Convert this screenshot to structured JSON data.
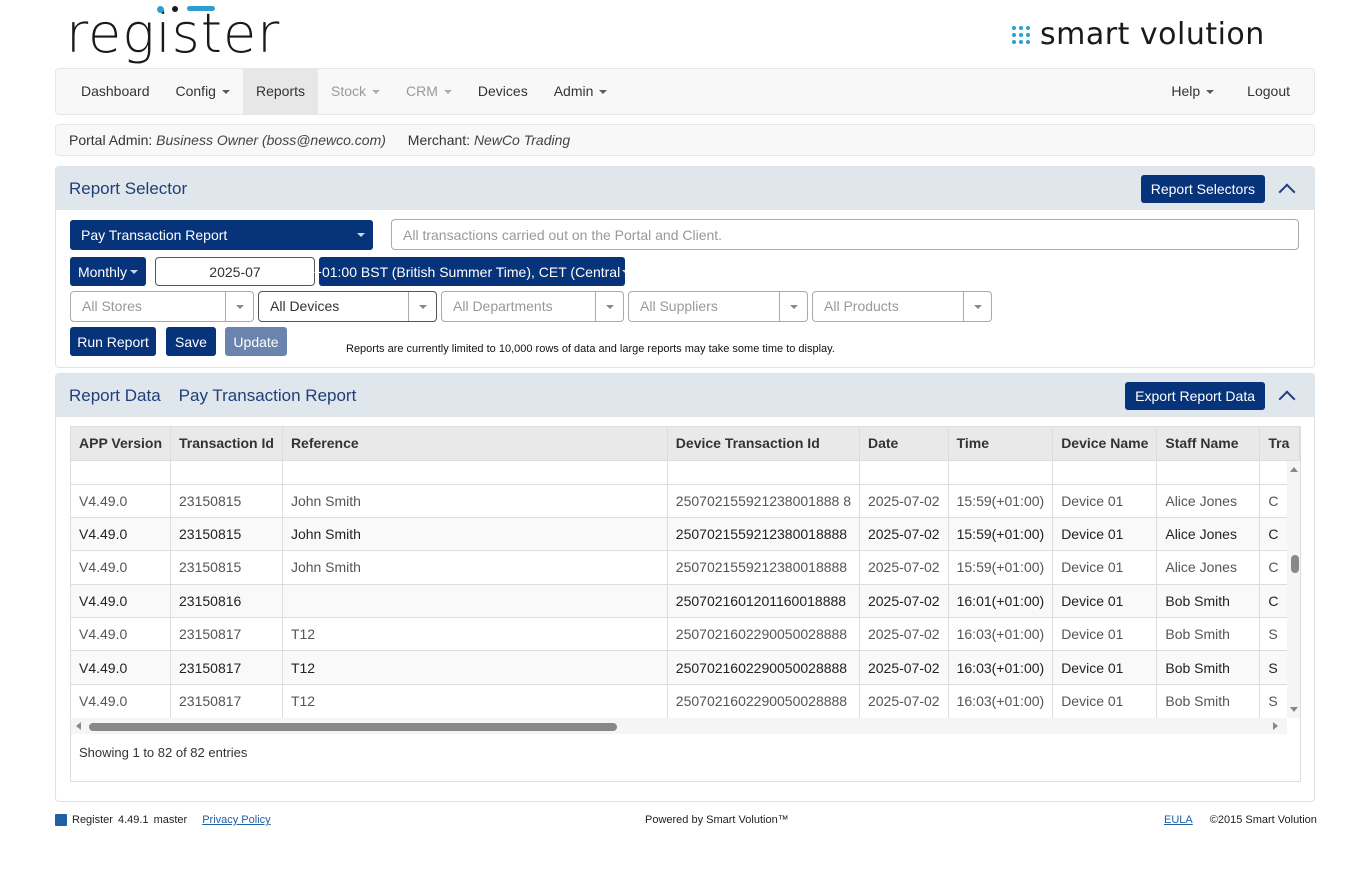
{
  "brand": {
    "logo": "register",
    "partner_logo": "smart volution",
    "accent": "#2a9fd0",
    "primary": "#06337a"
  },
  "nav": {
    "items": [
      {
        "label": "Dashboard",
        "dropdown": false,
        "state": "normal"
      },
      {
        "label": "Config",
        "dropdown": true,
        "state": "normal"
      },
      {
        "label": "Reports",
        "dropdown": false,
        "state": "active"
      },
      {
        "label": "Stock",
        "dropdown": true,
        "state": "disabled"
      },
      {
        "label": "CRM",
        "dropdown": true,
        "state": "disabled"
      },
      {
        "label": "Devices",
        "dropdown": false,
        "state": "normal"
      },
      {
        "label": "Admin",
        "dropdown": true,
        "state": "normal"
      }
    ],
    "help": "Help",
    "logout": "Logout"
  },
  "info": {
    "role_label": "Portal Admin:",
    "user": "Business Owner (boss@newco.com)",
    "merchant_label": "Merchant:",
    "merchant": "NewCo Trading"
  },
  "selector": {
    "title": "Report Selector",
    "selectors_button": "Report Selectors",
    "report": "Pay Transaction Report",
    "description_placeholder": "All transactions carried out on the Portal and Client.",
    "period": "Monthly",
    "date": "2025-07",
    "timezone": "+01:00 BST (British Summer Time), CET (Central",
    "filters": [
      {
        "label": "All Stores",
        "selected": false
      },
      {
        "label": "All Devices",
        "selected": true
      },
      {
        "label": "All Departments",
        "selected": false
      },
      {
        "label": "All Suppliers",
        "selected": false
      },
      {
        "label": "All Products",
        "selected": false
      }
    ],
    "run": "Run Report",
    "save": "Save",
    "update": "Update",
    "note": "Reports are currently limited to 10,000 rows of data and large reports may take some time to display."
  },
  "data": {
    "title": "Report Data",
    "subtitle": "Pay Transaction Report",
    "export": "Export Report Data",
    "columns": [
      "APP Version",
      "Transaction Id",
      "Reference",
      "Device Transaction Id",
      "Date",
      "Time",
      "Device Name",
      "Staff Name",
      "Tra"
    ],
    "rows": [
      [
        "V4.49.0",
        "23150815",
        "John Smith",
        "250702155921238001888 8",
        "2025-07-02",
        "15:59(+01:00)",
        "Device 01",
        "Alice Jones",
        "C"
      ],
      [
        "V4.49.0",
        "23150815",
        "John Smith",
        "2507021559212380018888",
        "2025-07-02",
        "15:59(+01:00)",
        "Device 01",
        "Alice Jones",
        "C"
      ],
      [
        "V4.49.0",
        "23150815",
        "John Smith",
        "2507021559212380018888",
        "2025-07-02",
        "15:59(+01:00)",
        "Device 01",
        "Alice Jones",
        "C"
      ],
      [
        "V4.49.0",
        "23150816",
        "",
        "2507021601201160018888",
        "2025-07-02",
        "16:01(+01:00)",
        "Device 01",
        "Bob Smith",
        "C"
      ],
      [
        "V4.49.0",
        "23150817",
        "T12",
        "2507021602290050028888",
        "2025-07-02",
        "16:03(+01:00)",
        "Device 01",
        "Bob Smith",
        "S"
      ],
      [
        "V4.49.0",
        "23150817",
        "T12",
        "2507021602290050028888",
        "2025-07-02",
        "16:03(+01:00)",
        "Device 01",
        "Bob Smith",
        "S"
      ],
      [
        "V4.49.0",
        "23150817",
        "T12",
        "2507021602290050028888",
        "2025-07-02",
        "16:03(+01:00)",
        "Device 01",
        "Bob Smith",
        "S"
      ]
    ],
    "showing": "Showing 1 to 82 of 82 entries"
  },
  "footer": {
    "app": "Register",
    "version": "4.49.1",
    "branch": "master",
    "privacy": "Privacy Policy",
    "powered": "Powered by Smart Volution™",
    "eula": "EULA",
    "copyright": "©2015 Smart Volution"
  }
}
